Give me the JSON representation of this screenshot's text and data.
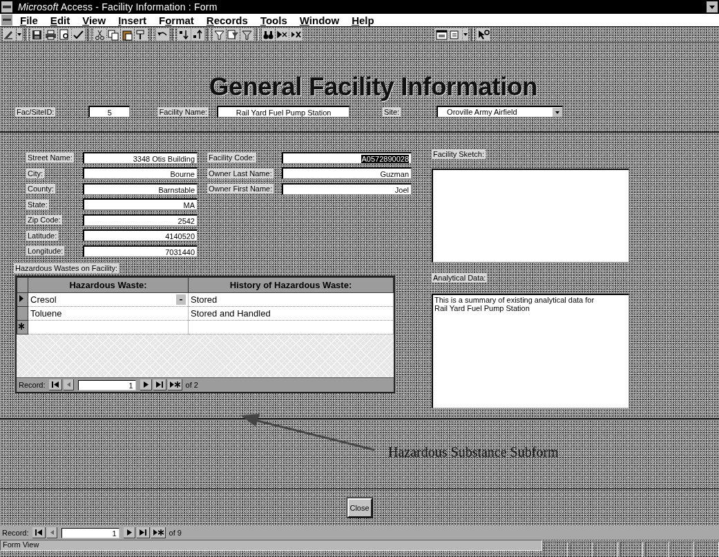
{
  "window": {
    "title": "*Microsoft* Access - Facility Information : Form"
  },
  "menu": [
    {
      "key": "F",
      "after": "ile"
    },
    {
      "key": "E",
      "after": "dit"
    },
    {
      "key": "V",
      "after": "iew"
    },
    {
      "key": "I",
      "after": "nsert"
    },
    {
      "before": "F",
      "key": "o",
      "after": "rmat"
    },
    {
      "key": "R",
      "after": "ecords"
    },
    {
      "key": "T",
      "after": "ools"
    },
    {
      "key": "W",
      "after": "indow"
    },
    {
      "key": "H",
      "after": "elp"
    }
  ],
  "form": {
    "title": "General Facility Information",
    "header_fields": [
      {
        "label": "Fac/SiteID:",
        "value": "5",
        "kind": "text"
      },
      {
        "label": "Facility Name:",
        "value": "Rail Yard Fuel Pump Station",
        "kind": "text"
      },
      {
        "label": "Site:",
        "value": "Oroville Army Airfield",
        "kind": "combo"
      }
    ],
    "address_fields": [
      {
        "label": "Street Name:",
        "value": "3348 Otis Building"
      },
      {
        "label": "City:",
        "value": "Bourne"
      },
      {
        "label": "County:",
        "value": "Barnstable"
      },
      {
        "label": "State:",
        "value": "MA"
      },
      {
        "label": "Zip Code:",
        "value": "2542"
      },
      {
        "label": "Latitude:",
        "value": "4140520"
      },
      {
        "label": "Longitude:",
        "value": "7031440"
      }
    ],
    "owner_fields": [
      {
        "label": "Facility Code:",
        "value": "A0572890028",
        "highlighted": true
      },
      {
        "label": "Owner Last Name:",
        "value": "Guzman",
        "highlighted": false
      },
      {
        "label": "Owner First Name:",
        "value": "Joel",
        "highlighted": false
      }
    ],
    "sketch": {
      "label": "Facility Sketch:"
    },
    "analytical": {
      "label": "Analytical Data:",
      "value": "This is a summary of existing analytical data for\nRail Yard Fuel Pump Station"
    },
    "subform": {
      "label": "Hazardous Wastes on Facility:",
      "columns": [
        "Hazardous Waste:",
        "History of Hazardous Waste:"
      ],
      "rows": [
        {
          "kind": "record",
          "current": true,
          "cells": [
            "Cresol",
            "Stored"
          ]
        },
        {
          "kind": "record",
          "current": false,
          "cells": [
            "Toluene",
            "Stored and Handled"
          ]
        },
        {
          "kind": "new",
          "current": false,
          "cells": []
        }
      ],
      "nav": {
        "label": "Record:",
        "value": "1",
        "total": "of 2"
      }
    },
    "annotation": "Hazardous Substance Subform",
    "close_button": "Close"
  },
  "record_nav": {
    "label": "Record:",
    "value": "1",
    "total": "of 9"
  },
  "status_bar": {
    "text": "Form View"
  }
}
